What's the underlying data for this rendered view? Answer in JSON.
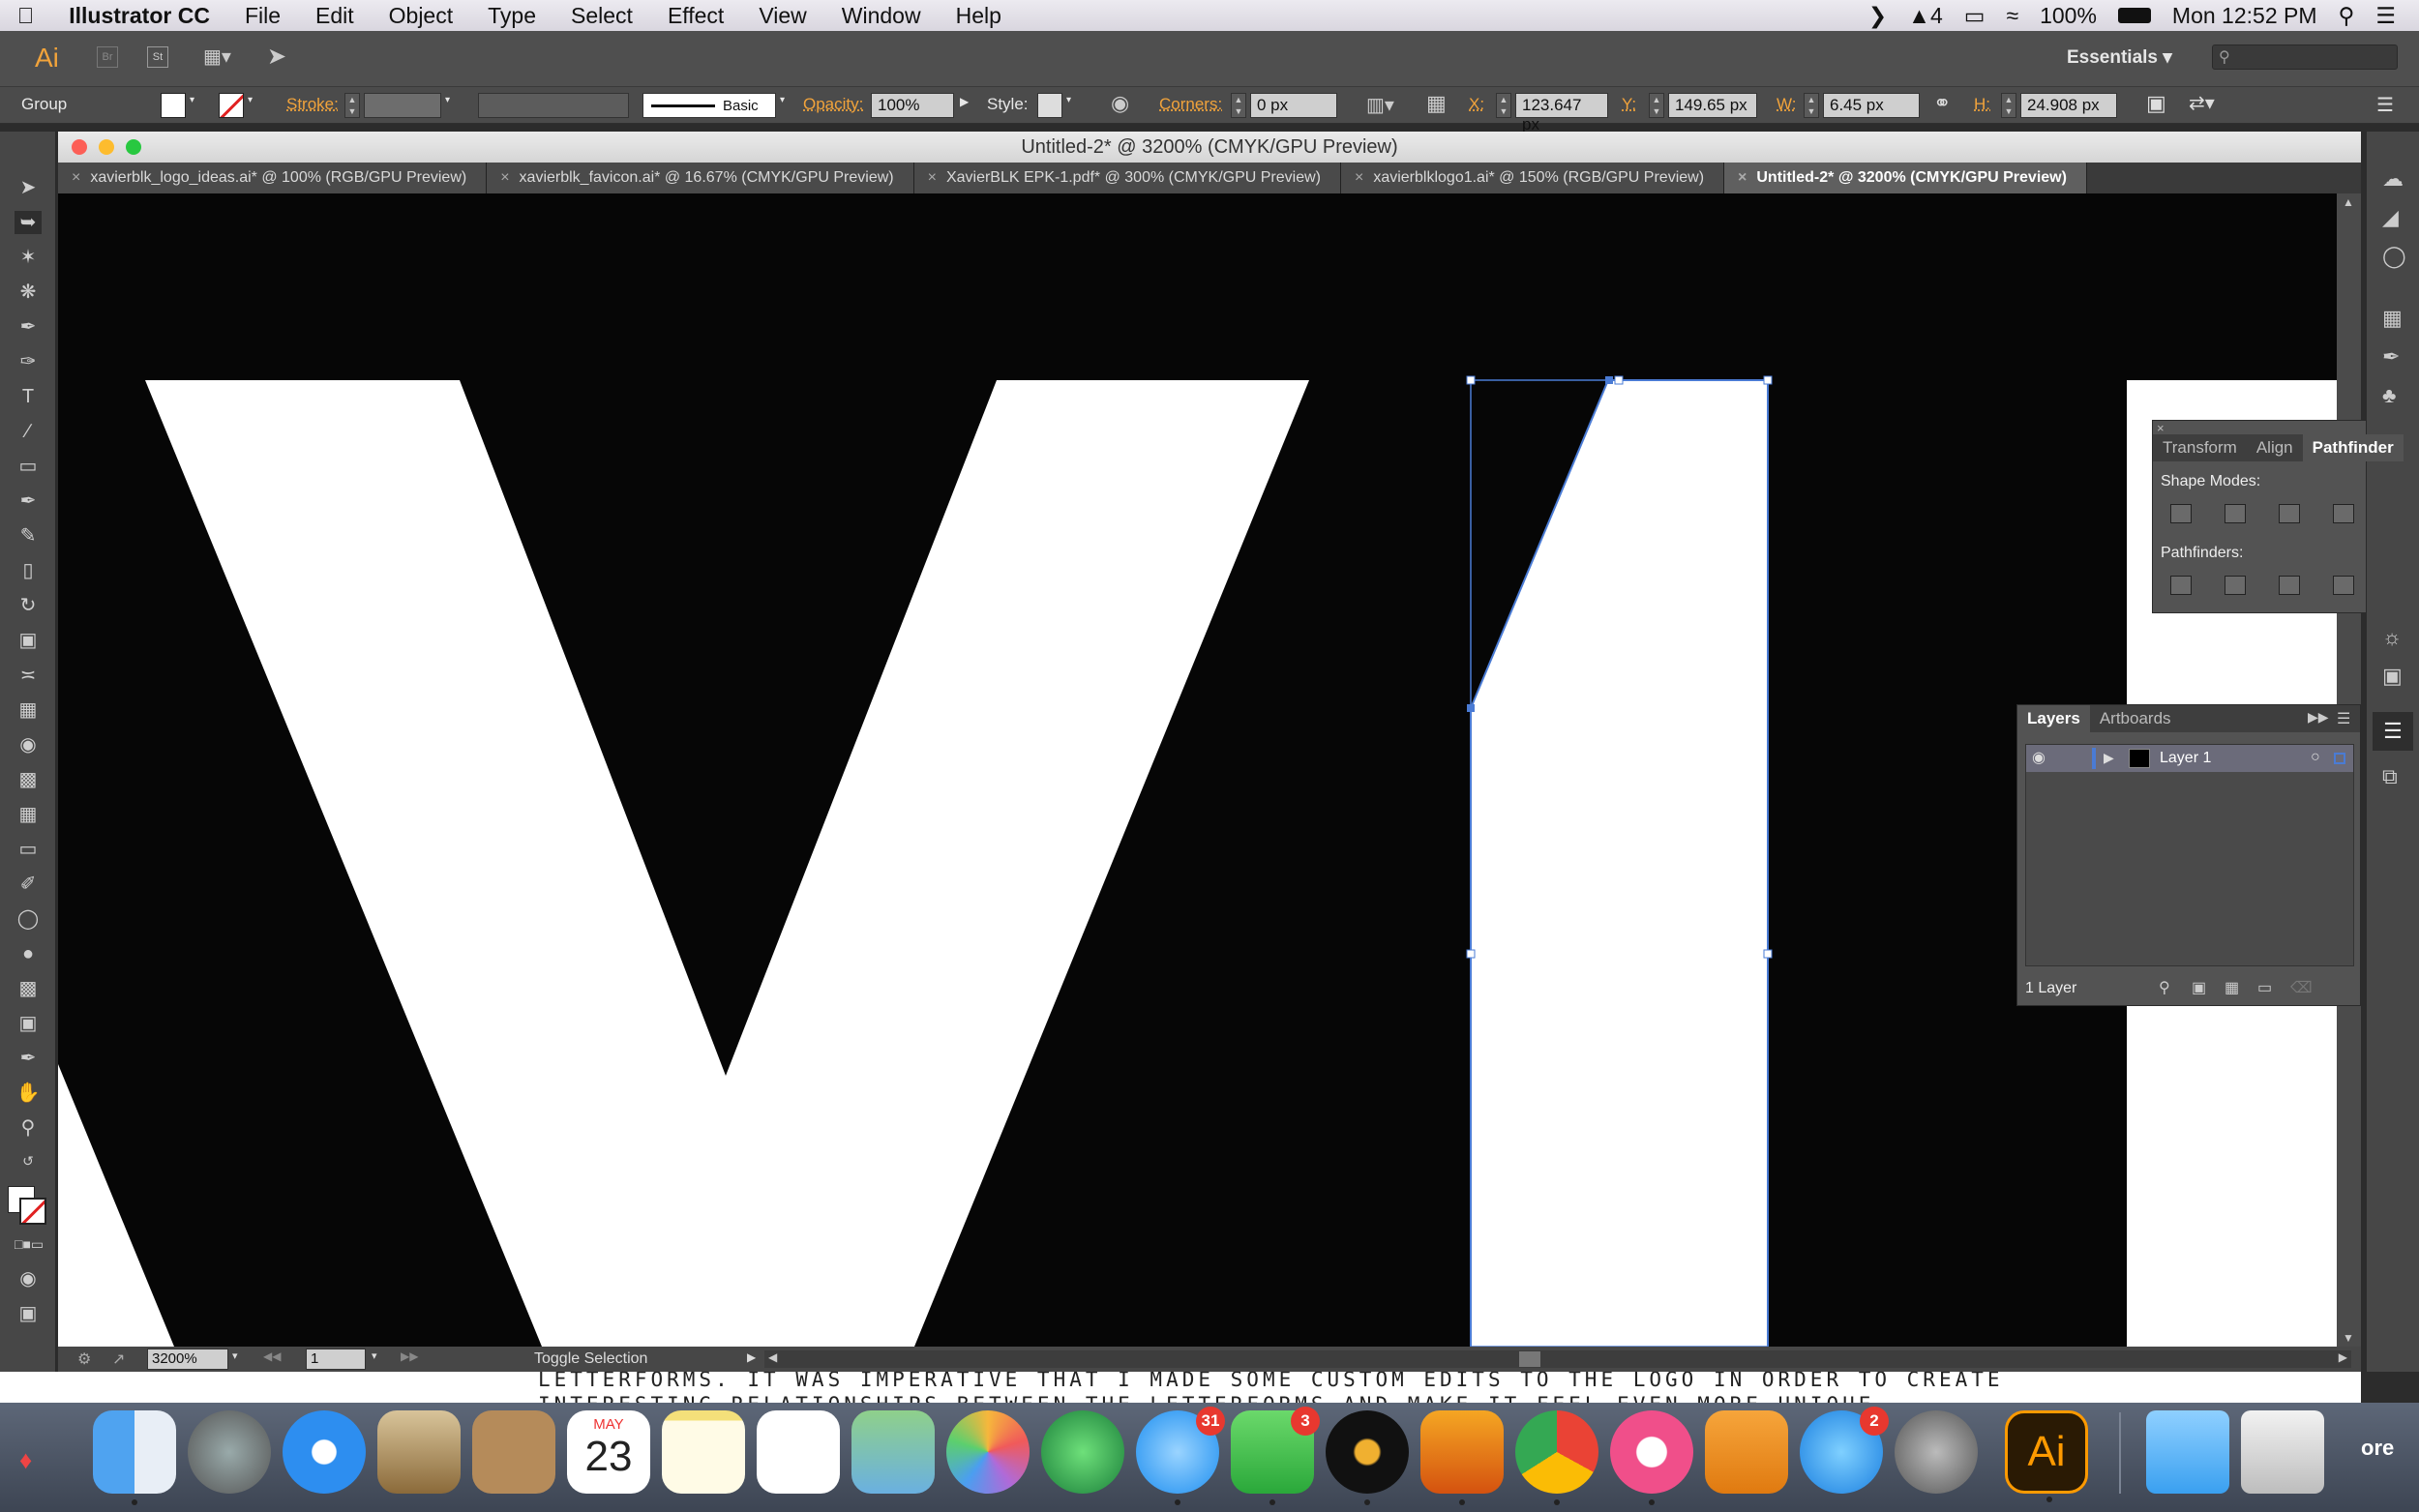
{
  "menubar": {
    "app_name": "Illustrator CC",
    "items": [
      "File",
      "Edit",
      "Object",
      "Type",
      "Select",
      "Effect",
      "View",
      "Window",
      "Help"
    ],
    "status": {
      "adobe_count": "4",
      "battery": "100%",
      "datetime": "Mon 12:52 PM"
    }
  },
  "appbar": {
    "workspace": "Essentials",
    "logo": "Ai",
    "br": "Br",
    "st": "St"
  },
  "control": {
    "selection_type": "Group",
    "stroke_label": "Stroke:",
    "brush_label": "Basic",
    "opacity_label": "Opacity:",
    "opacity_value": "100%",
    "style_label": "Style:",
    "corners_label": "Corners:",
    "corners_value": "0 px",
    "x_label": "X:",
    "x_value": "123.647 px",
    "y_label": "Y:",
    "y_value": "149.65 px",
    "w_label": "W:",
    "w_value": "6.45 px",
    "h_label": "H:",
    "h_value": "24.908 px"
  },
  "document": {
    "title": "Untitled-2* @ 3200% (CMYK/GPU Preview)",
    "tabs": [
      {
        "label": "xavierblk_logo_ideas.ai* @ 100% (RGB/GPU Preview)"
      },
      {
        "label": "xavierblk_favicon.ai* @ 16.67% (CMYK/GPU Preview)"
      },
      {
        "label": "XavierBLK EPK-1.pdf* @ 300% (CMYK/GPU Preview)"
      },
      {
        "label": "xavierblklogo1.ai* @ 150% (RGB/GPU Preview)"
      },
      {
        "label": "Untitled-2* @ 3200% (CMYK/GPU Preview)"
      }
    ],
    "zoom": "3200%",
    "artboard": "1",
    "status_text": "Toggle Selection"
  },
  "background_text": {
    "line1": "LETTERFORMS. IT WAS IMPERATIVE THAT I MADE SOME CUSTOM EDITS TO THE LOGO IN ORDER TO CREATE",
    "line2": "INTERESTING RELATIONSHIPS BETWEEN THE LETTERFORMS AND MAKE IT FEEL EVEN MORE UNIQUE"
  },
  "pathfinder_panel": {
    "tabs": [
      "Transform",
      "Align",
      "Pathfinder"
    ],
    "shape_modes_label": "Shape Modes:",
    "pathfinders_label": "Pathfinders:"
  },
  "layers_panel": {
    "tabs": [
      "Layers",
      "Artboards"
    ],
    "layer_name": "Layer 1",
    "count": "1 Layer"
  },
  "dock": {
    "calendar_month": "MAY",
    "calendar_day": "23",
    "messages_badge": "31",
    "facetime_badge": "3",
    "appstore_badge": "2",
    "ai_label": "Ai",
    "more_label": "ore"
  },
  "colors": {
    "selection": "#4a7bd4",
    "accent_orange": "#f1a33b",
    "ai_orange": "#ff9a00"
  }
}
